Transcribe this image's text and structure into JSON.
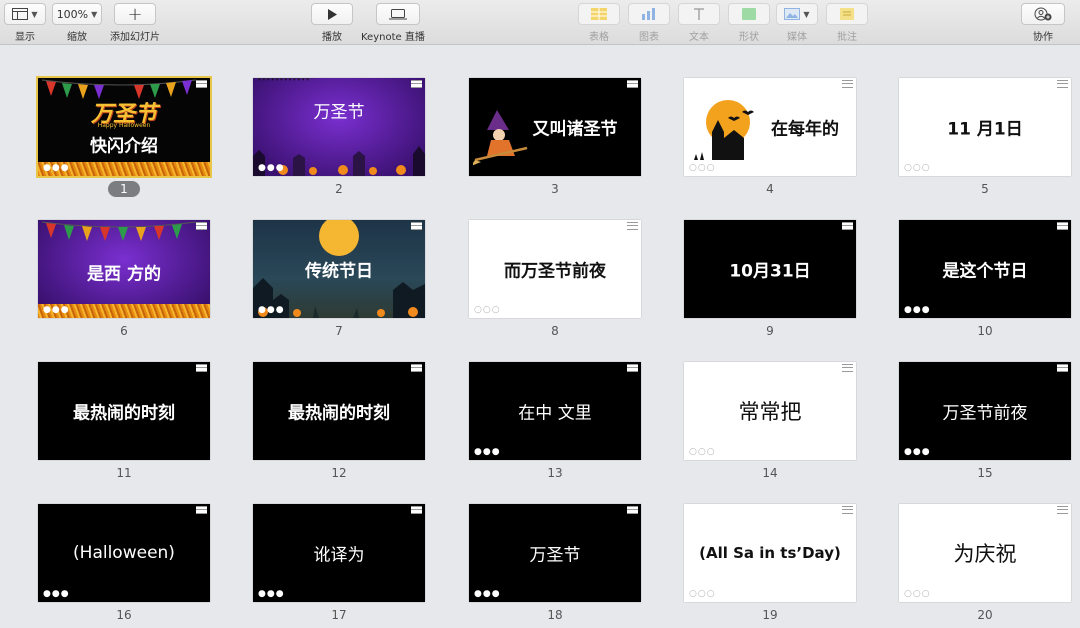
{
  "toolbar": {
    "view_label": "显示",
    "zoom_value": "100%",
    "zoom_label": "缩放",
    "add_slide_label": "添加幻灯片",
    "play_label": "播放",
    "live_label": "Keynote 直播",
    "table_label": "表格",
    "chart_label": "图表",
    "text_label": "文本",
    "shape_label": "形状",
    "media_label": "媒体",
    "comment_label": "批注",
    "collaborate_label": "协作"
  },
  "slides": [
    {
      "num": "1",
      "text": "快闪介绍",
      "title_art": "万圣节",
      "title_art_sub": "Happy Halloween"
    },
    {
      "num": "2",
      "text": "万圣节"
    },
    {
      "num": "3",
      "text": "又叫诸圣节"
    },
    {
      "num": "4",
      "text": "在每年的"
    },
    {
      "num": "5",
      "text": "11 月1日"
    },
    {
      "num": "6",
      "text": "是西  方的"
    },
    {
      "num": "7",
      "text": "传统节日"
    },
    {
      "num": "8",
      "text": "而万圣节前夜"
    },
    {
      "num": "9",
      "text": "10月31日"
    },
    {
      "num": "10",
      "text": "是这个节日"
    },
    {
      "num": "11",
      "text": "最热闹的时刻"
    },
    {
      "num": "12",
      "text": "最热闹的时刻"
    },
    {
      "num": "13",
      "text": "在中  文里"
    },
    {
      "num": "14",
      "text": "常常把"
    },
    {
      "num": "15",
      "text": "万圣节前夜"
    },
    {
      "num": "16",
      "text": "(Halloween)"
    },
    {
      "num": "17",
      "text": "讹译为"
    },
    {
      "num": "18",
      "text": "万圣节"
    },
    {
      "num": "19",
      "text": "(All Sa in ts’Day)"
    },
    {
      "num": "20",
      "text": "为庆祝"
    }
  ],
  "slide_dots": "●●●",
  "slide_dots_hollow": "○○○",
  "colors": {
    "accent_moon": "#f3a21d",
    "selection": "#e8c64a",
    "grass": "#e58a10",
    "purple": "#7a2fd0"
  }
}
